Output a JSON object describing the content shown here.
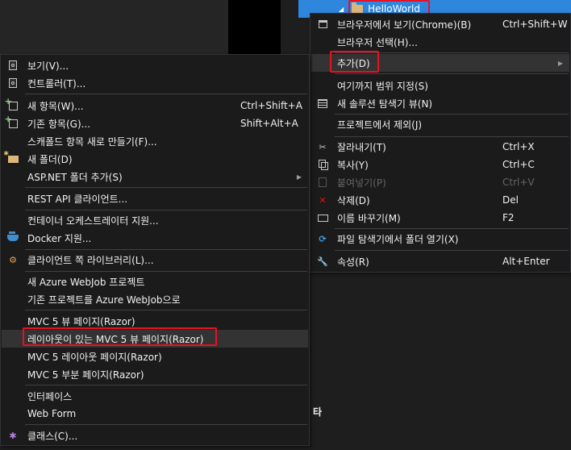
{
  "solution_explorer": {
    "selected_node": "HelloWorld",
    "bottom_text": "타"
  },
  "project_menu": {
    "items": [
      {
        "label": "브라우저에서 보기(Chrome)(B)",
        "shortcut": "Ctrl+Shift+W",
        "icon": "browser-icon"
      },
      {
        "label": "브라우저 선택(H)...",
        "shortcut": "",
        "icon": ""
      },
      {
        "label": "추가(D)",
        "shortcut": "",
        "icon": "",
        "submenu": true,
        "highlighted": true
      },
      {
        "label": "여기까지 범위 지정(S)",
        "shortcut": "",
        "icon": ""
      },
      {
        "label": "새 솔루션 탐색기 뷰(N)",
        "shortcut": "",
        "icon": "new-solution-view-icon"
      },
      {
        "label": "프로젝트에서 제외(J)",
        "shortcut": "",
        "icon": ""
      },
      {
        "label": "잘라내기(T)",
        "shortcut": "Ctrl+X",
        "icon": "scissors-icon"
      },
      {
        "label": "복사(Y)",
        "shortcut": "Ctrl+C",
        "icon": "copy-icon"
      },
      {
        "label": "붙여넣기(P)",
        "shortcut": "Ctrl+V",
        "icon": "paste-icon",
        "disabled": true
      },
      {
        "label": "삭제(D)",
        "shortcut": "Del",
        "icon": "delete-icon"
      },
      {
        "label": "이름 바꾸기(M)",
        "shortcut": "F2",
        "icon": "rename-icon"
      },
      {
        "label": "파일 탐색기에서 폴더 열기(X)",
        "shortcut": "",
        "icon": "refresh-icon"
      },
      {
        "label": "속성(R)",
        "shortcut": "Alt+Enter",
        "icon": "wrench-icon"
      }
    ],
    "submenu_arrow": "▶"
  },
  "add_submenu": {
    "items": [
      {
        "label": "보기(V)...",
        "shortcut": "",
        "icon": "view-icon"
      },
      {
        "label": "컨트롤러(T)...",
        "shortcut": "",
        "icon": "controller-icon"
      },
      {
        "label": "새 항목(W)...",
        "shortcut": "Ctrl+Shift+A",
        "icon": "new-item-icon"
      },
      {
        "label": "기존 항목(G)...",
        "shortcut": "Shift+Alt+A",
        "icon": "existing-item-icon"
      },
      {
        "label": "스캐폴드 항목 새로 만들기(F)...",
        "shortcut": "",
        "icon": ""
      },
      {
        "label": "새 폴더(D)",
        "shortcut": "",
        "icon": "new-folder-icon"
      },
      {
        "label": "ASP.NET 폴더 추가(S)",
        "shortcut": "",
        "icon": "",
        "submenu": true
      },
      {
        "label": "REST API 클라이언트...",
        "shortcut": "",
        "icon": ""
      },
      {
        "label": "컨테이너 오케스트레이터 지원...",
        "shortcut": "",
        "icon": ""
      },
      {
        "label": "Docker 지원...",
        "shortcut": "",
        "icon": "docker-icon"
      },
      {
        "label": "클라이언트 쪽 라이브러리(L)...",
        "shortcut": "",
        "icon": "library-icon"
      },
      {
        "label": "새 Azure WebJob 프로젝트",
        "shortcut": "",
        "icon": ""
      },
      {
        "label": "기존 프로젝트를 Azure WebJob으로",
        "shortcut": "",
        "icon": ""
      },
      {
        "label": "MVC 5 뷰 페이지(Razor)",
        "shortcut": "",
        "icon": ""
      },
      {
        "label": "레이아웃이 있는 MVC 5 뷰 페이지(Razor)",
        "shortcut": "",
        "icon": "",
        "highlighted": true
      },
      {
        "label": "MVC 5 레이아웃 페이지(Razor)",
        "shortcut": "",
        "icon": ""
      },
      {
        "label": "MVC 5 부분 페이지(Razor)",
        "shortcut": "",
        "icon": ""
      },
      {
        "label": "인터페이스",
        "shortcut": "",
        "icon": ""
      },
      {
        "label": "Web Form",
        "shortcut": "",
        "icon": ""
      },
      {
        "label": "클래스(C)...",
        "shortcut": "",
        "icon": "class-icon"
      }
    ],
    "submenu_arrow": "▶"
  }
}
